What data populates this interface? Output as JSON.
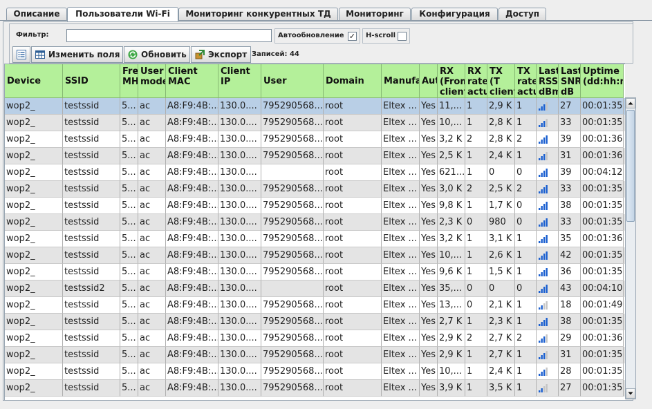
{
  "tabs": [
    {
      "label": "Описание",
      "active": false
    },
    {
      "label": "Пользователи Wi-Fi",
      "active": true
    },
    {
      "label": "Мониторинг конкурентных ТД",
      "active": false
    },
    {
      "label": "Мониторинг",
      "active": false
    },
    {
      "label": "Конфигурация",
      "active": false
    },
    {
      "label": "Доступ",
      "active": false
    }
  ],
  "filter": {
    "label": "Фильтр:",
    "value": ""
  },
  "auto_update": {
    "label": "Автообновление",
    "checked": true,
    "check_glyph": "✓"
  },
  "h_scroll": {
    "label": "H-scroll",
    "checked": false
  },
  "toolbar": {
    "columns_icon": "list-icon",
    "edit_fields": "Изменить поля",
    "refresh": "Обновить",
    "export": "Экспорт"
  },
  "records_label": "Записей: 44",
  "colors": {
    "header_bg": "#b4f09a",
    "selected_row": "#b9cfe6",
    "alt_row": "#e4e4e4",
    "signal_bar": "#1a5fd0"
  },
  "columns": [
    {
      "label": "Device"
    },
    {
      "label": "SSID"
    },
    {
      "label": "Fre MH"
    },
    {
      "label": "User mode"
    },
    {
      "label": "Client MAC"
    },
    {
      "label": "Client IP"
    },
    {
      "label": "User"
    },
    {
      "label": "Domain"
    },
    {
      "label": "Manufa"
    },
    {
      "label": "Aut"
    },
    {
      "label": "RX (From client"
    },
    {
      "label": "RX rate actu"
    },
    {
      "label": "TX (T client byte"
    },
    {
      "label": "TX rate actu"
    },
    {
      "label": "Last RSS dBm"
    },
    {
      "label": "Last SNR dB"
    },
    {
      "label": "Uptime (dd:hh:m"
    }
  ],
  "rows": [
    {
      "device": "wop2_",
      "ssid": "testssid",
      "freq": "5...",
      "mode": "ac",
      "mac": "A8:F9:4B:...",
      "ip": "130.0....",
      "user": "795290568...",
      "domain": "root",
      "manuf": "Eltex ...",
      "auth": "Yes",
      "rx": "11,...",
      "rxrate": "1",
      "tx": "2,9 K",
      "txrate": "1",
      "rssi_level": 3,
      "snr": "27",
      "uptime": "00:01:35"
    },
    {
      "device": "wop2_",
      "ssid": "testssid",
      "freq": "5...",
      "mode": "ac",
      "mac": "A8:F9:4B:...",
      "ip": "130.0....",
      "user": "795290568...",
      "domain": "root",
      "manuf": "Eltex ...",
      "auth": "Yes",
      "rx": "10,...",
      "rxrate": "1",
      "tx": "2,8 K",
      "txrate": "1",
      "rssi_level": 3,
      "snr": "33",
      "uptime": "00:01:35"
    },
    {
      "device": "wop2_",
      "ssid": "testssid",
      "freq": "5...",
      "mode": "ac",
      "mac": "A8:F9:4B:...",
      "ip": "130.0....",
      "user": "795290568...",
      "domain": "root",
      "manuf": "Eltex ...",
      "auth": "Yes",
      "rx": "3,2 K",
      "rxrate": "2",
      "tx": "2,8 K",
      "txrate": "2",
      "rssi_level": 4,
      "snr": "39",
      "uptime": "00:01:36"
    },
    {
      "device": "wop2_",
      "ssid": "testssid",
      "freq": "5...",
      "mode": "ac",
      "mac": "A8:F9:4B:...",
      "ip": "130.0....",
      "user": "795290568...",
      "domain": "root",
      "manuf": "Eltex ...",
      "auth": "Yes",
      "rx": "2,5 K",
      "rxrate": "1",
      "tx": "2,4 K",
      "txrate": "1",
      "rssi_level": 3,
      "snr": "31",
      "uptime": "00:01:36"
    },
    {
      "device": "wop2_",
      "ssid": "testssid",
      "freq": "5...",
      "mode": "ac",
      "mac": "A8:F9:4B:...",
      "ip": "130.0....",
      "user": "",
      "domain": "root",
      "manuf": "Eltex ...",
      "auth": "Yes",
      "rx": "621...",
      "rxrate": "1",
      "tx": "0",
      "txrate": "0",
      "rssi_level": 4,
      "snr": "39",
      "uptime": "00:04:12"
    },
    {
      "device": "wop2_",
      "ssid": "testssid",
      "freq": "5...",
      "mode": "ac",
      "mac": "A8:F9:4B:...",
      "ip": "130.0....",
      "user": "795290568...",
      "domain": "root",
      "manuf": "Eltex ...",
      "auth": "Yes",
      "rx": "3,0 K",
      "rxrate": "2",
      "tx": "2,5 K",
      "txrate": "2",
      "rssi_level": 4,
      "snr": "33",
      "uptime": "00:01:35"
    },
    {
      "device": "wop2_",
      "ssid": "testssid",
      "freq": "5...",
      "mode": "ac",
      "mac": "A8:F9:4B:...",
      "ip": "130.0....",
      "user": "795290568...",
      "domain": "root",
      "manuf": "Eltex ...",
      "auth": "Yes",
      "rx": "9,8 K",
      "rxrate": "1",
      "tx": "1,7 K",
      "txrate": "0",
      "rssi_level": 4,
      "snr": "38",
      "uptime": "00:01:35"
    },
    {
      "device": "wop2_",
      "ssid": "testssid",
      "freq": "5...",
      "mode": "ac",
      "mac": "A8:F9:4B:...",
      "ip": "130.0....",
      "user": "795290568...",
      "domain": "root",
      "manuf": "Eltex ...",
      "auth": "Yes",
      "rx": "2,3 K",
      "rxrate": "0",
      "tx": "980",
      "txrate": "0",
      "rssi_level": 4,
      "snr": "33",
      "uptime": "00:01:35"
    },
    {
      "device": "wop2_",
      "ssid": "testssid",
      "freq": "5...",
      "mode": "ac",
      "mac": "A8:F9:4B:...",
      "ip": "130.0....",
      "user": "795290568...",
      "domain": "root",
      "manuf": "Eltex ...",
      "auth": "Yes",
      "rx": "3,2 K",
      "rxrate": "1",
      "tx": "3,1 K",
      "txrate": "1",
      "rssi_level": 4,
      "snr": "35",
      "uptime": "00:01:36"
    },
    {
      "device": "wop2_",
      "ssid": "testssid",
      "freq": "5...",
      "mode": "ac",
      "mac": "A8:F9:4B:...",
      "ip": "130.0....",
      "user": "795290568...",
      "domain": "root",
      "manuf": "Eltex ...",
      "auth": "Yes",
      "rx": "10,...",
      "rxrate": "1",
      "tx": "2,6 K",
      "txrate": "1",
      "rssi_level": 4,
      "snr": "42",
      "uptime": "00:01:35"
    },
    {
      "device": "wop2_",
      "ssid": "testssid",
      "freq": "5...",
      "mode": "ac",
      "mac": "A8:F9:4B:...",
      "ip": "130.0....",
      "user": "795290568...",
      "domain": "root",
      "manuf": "Eltex ...",
      "auth": "Yes",
      "rx": "9,6 K",
      "rxrate": "1",
      "tx": "1,5 K",
      "txrate": "1",
      "rssi_level": 4,
      "snr": "36",
      "uptime": "00:01:35"
    },
    {
      "device": "wop2_",
      "ssid": "testssid2",
      "freq": "5...",
      "mode": "ac",
      "mac": "A8:F9:4B:...",
      "ip": "130.0....",
      "user": "",
      "domain": "root",
      "manuf": "Eltex ...",
      "auth": "Yes",
      "rx": "35,...",
      "rxrate": "0",
      "tx": "0",
      "txrate": "0",
      "rssi_level": 4,
      "snr": "43",
      "uptime": "00:04:10"
    },
    {
      "device": "wop2_",
      "ssid": "testssid",
      "freq": "5...",
      "mode": "ac",
      "mac": "A8:F9:4B:...",
      "ip": "130.0....",
      "user": "795290568...",
      "domain": "root",
      "manuf": "Eltex ...",
      "auth": "Yes",
      "rx": "13,...",
      "rxrate": "0",
      "tx": "2,1 K",
      "txrate": "1",
      "rssi_level": 2,
      "snr": "18",
      "uptime": "00:01:49"
    },
    {
      "device": "wop2_",
      "ssid": "testssid",
      "freq": "5...",
      "mode": "ac",
      "mac": "A8:F9:4B:...",
      "ip": "130.0....",
      "user": "795290568...",
      "domain": "root",
      "manuf": "Eltex ...",
      "auth": "Yes",
      "rx": "2,7 K",
      "rxrate": "1",
      "tx": "2,3 K",
      "txrate": "1",
      "rssi_level": 4,
      "snr": "38",
      "uptime": "00:01:35"
    },
    {
      "device": "wop2_",
      "ssid": "testssid",
      "freq": "5...",
      "mode": "ac",
      "mac": "A8:F9:4B:...",
      "ip": "130.0....",
      "user": "795290568...",
      "domain": "root",
      "manuf": "Eltex ...",
      "auth": "Yes",
      "rx": "2,9 K",
      "rxrate": "2",
      "tx": "2,7 K",
      "txrate": "2",
      "rssi_level": 3,
      "snr": "29",
      "uptime": "00:01:36"
    },
    {
      "device": "wop2_",
      "ssid": "testssid",
      "freq": "5...",
      "mode": "ac",
      "mac": "A8:F9:4B:...",
      "ip": "130.0....",
      "user": "795290568...",
      "domain": "root",
      "manuf": "Eltex ...",
      "auth": "Yes",
      "rx": "2,9 K",
      "rxrate": "1",
      "tx": "2,7 K",
      "txrate": "1",
      "rssi_level": 3,
      "snr": "31",
      "uptime": "00:01:35"
    },
    {
      "device": "wop2_",
      "ssid": "testssid",
      "freq": "5...",
      "mode": "ac",
      "mac": "A8:F9:4B:...",
      "ip": "130.0....",
      "user": "795290568...",
      "domain": "root",
      "manuf": "Eltex ...",
      "auth": "Yes",
      "rx": "10,...",
      "rxrate": "1",
      "tx": "2,4 K",
      "txrate": "1",
      "rssi_level": 3,
      "snr": "28",
      "uptime": "00:01:35"
    },
    {
      "device": "wop2_",
      "ssid": "testssid",
      "freq": "5...",
      "mode": "ac",
      "mac": "A8:F9:4B:...",
      "ip": "130.0....",
      "user": "795290568...",
      "domain": "root",
      "manuf": "Eltex ...",
      "auth": "Yes",
      "rx": "3,9 K",
      "rxrate": "1",
      "tx": "3,5 K",
      "txrate": "1",
      "rssi_level": 2,
      "snr": "27",
      "uptime": "00:01:35"
    }
  ]
}
